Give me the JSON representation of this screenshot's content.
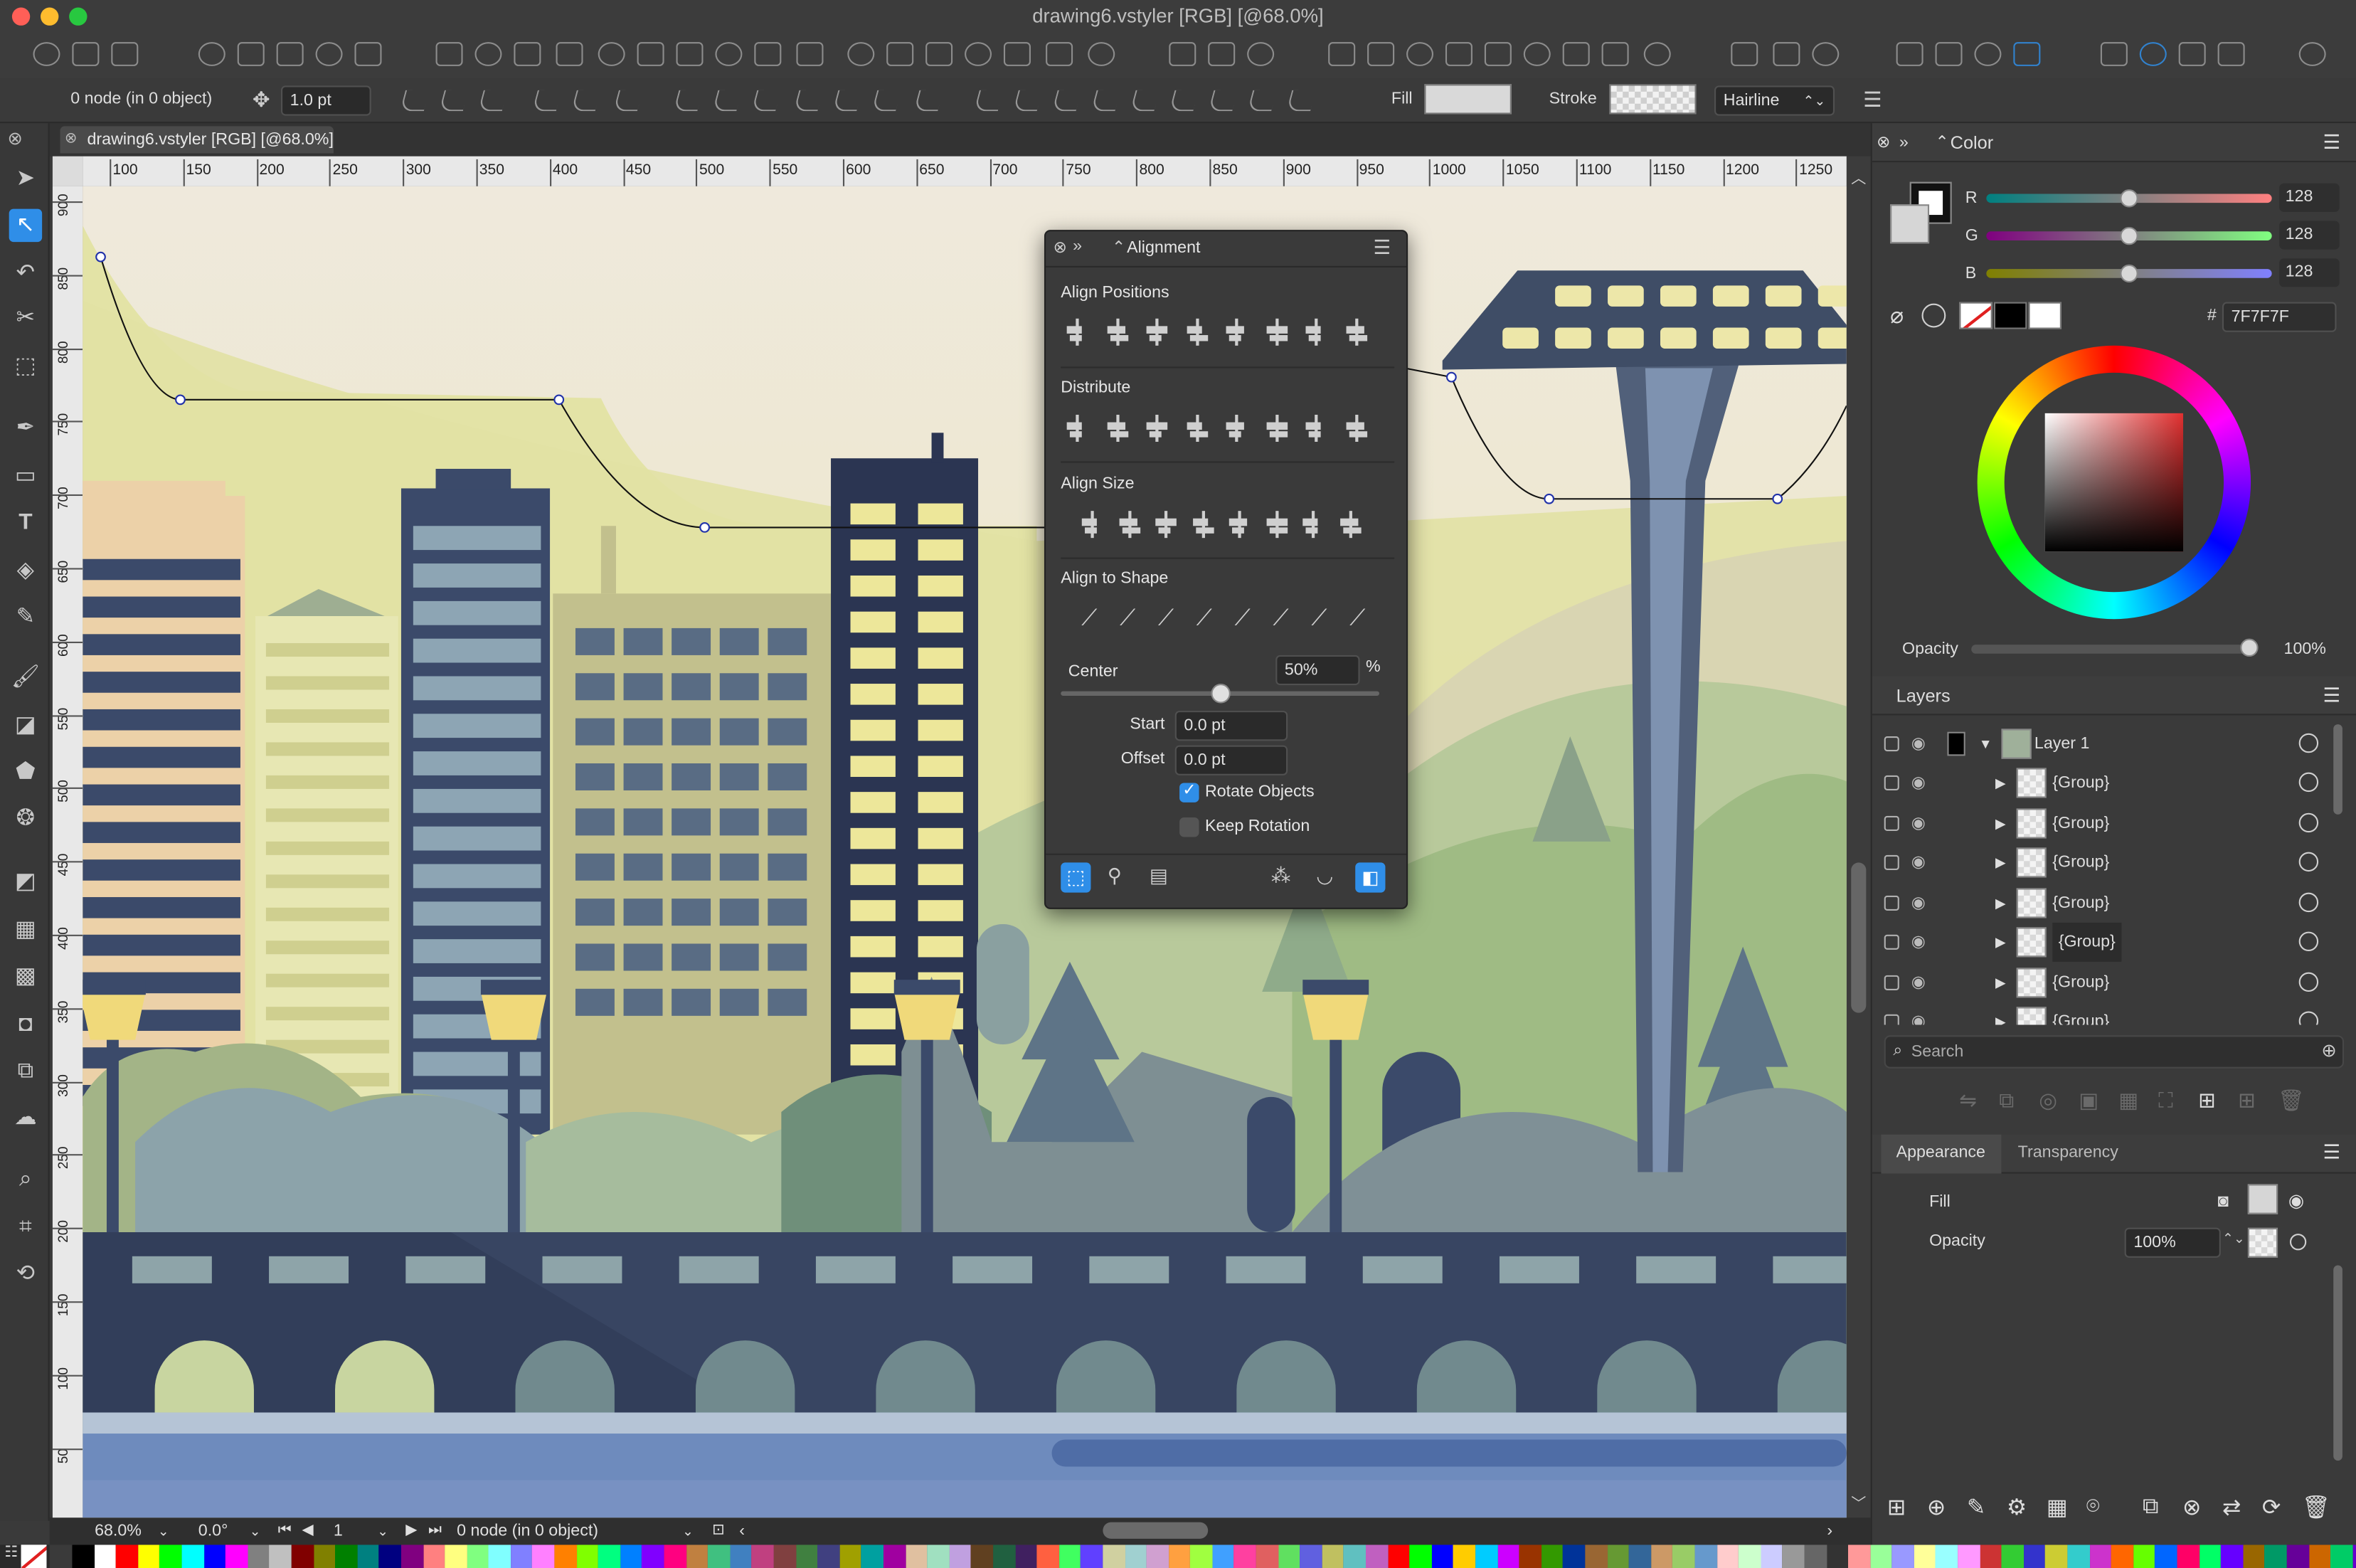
{
  "window": {
    "title": "drawing6.vstyler [RGB] [@68.0%]"
  },
  "toolbar": {
    "node_status": "0 node (in 0 object)",
    "stroke_width_value": "1.0 pt",
    "fill_label": "Fill",
    "stroke_label": "Stroke",
    "stroke_style": "Hairline"
  },
  "document_tab": {
    "label": "drawing6.vstyler [RGB] [@68.0%]"
  },
  "ruler": {
    "top_ticks": [
      "100",
      "150",
      "200",
      "250",
      "300",
      "350",
      "400",
      "450",
      "500",
      "550",
      "600",
      "650",
      "700",
      "750",
      "800",
      "850",
      "900",
      "950",
      "1000",
      "1050",
      "1100",
      "1150",
      "1200",
      "1250"
    ],
    "left_ticks": [
      "900",
      "850",
      "800",
      "750",
      "700",
      "650",
      "600",
      "550",
      "500",
      "450",
      "400",
      "350",
      "300",
      "250",
      "200",
      "150",
      "100",
      "50"
    ]
  },
  "alignment_panel": {
    "title": "Alignment",
    "align_positions": "Align Positions",
    "distribute": "Distribute",
    "align_size": "Align Size",
    "align_to_shape": "Align to Shape",
    "center_label": "Center",
    "center_value": "50%",
    "center_unit": "%",
    "center_fraction": 0.5,
    "start_label": "Start",
    "start_value": "0.0 pt",
    "offset_label": "Offset",
    "offset_value": "0.0 pt",
    "rotate_objects": "Rotate Objects",
    "rotate_checked": true,
    "keep_rotation": "Keep Rotation",
    "keep_checked": false
  },
  "color_panel": {
    "title": "Color",
    "channels": [
      {
        "label": "R",
        "value": "128"
      },
      {
        "label": "G",
        "value": "128"
      },
      {
        "label": "B",
        "value": "128"
      }
    ],
    "hex_prefix": "#",
    "hex": "7F7F7F",
    "opacity_label": "Opacity",
    "opacity_value": "100%"
  },
  "layers_panel": {
    "title": "Layers",
    "root": "Layer 1",
    "groups": [
      "{Group}",
      "{Group}",
      "{Group}",
      "{Group}",
      "{Group}",
      "{Group}",
      "{Group}"
    ],
    "search_placeholder": "Search"
  },
  "appearance_panel": {
    "tabs": [
      "Appearance",
      "Transparency"
    ],
    "fill_label": "Fill",
    "opacity_label": "Opacity",
    "opacity_value": "100%"
  },
  "status_bar": {
    "zoom": "68.0%",
    "rotation": "0.0°",
    "page": "1",
    "node_status": "0 node (in 0 object)"
  },
  "colors": {
    "accent": "#2f8ee8",
    "panel_bg": "#3a3a3a",
    "canvas_sky": "#efe9dc"
  },
  "palette": [
    "#000000",
    "#ffffff",
    "#ff0000",
    "#ffff00",
    "#00ff00",
    "#00ffff",
    "#0000ff",
    "#ff00ff",
    "#808080",
    "#c0c0c0",
    "#800000",
    "#808000",
    "#008000",
    "#008080",
    "#000080",
    "#800080",
    "#ff8080",
    "#ffff80",
    "#80ff80",
    "#80ffff",
    "#8080ff",
    "#ff80ff",
    "#ff8000",
    "#80ff00",
    "#00ff80",
    "#0080ff",
    "#8000ff",
    "#ff0080",
    "#c08040",
    "#40c080",
    "#4080c0",
    "#c04080",
    "#804040",
    "#408040",
    "#404080",
    "#a0a000",
    "#00a0a0",
    "#a000a0",
    "#e0c0a0",
    "#a0e0c0",
    "#c0a0e0",
    "#604020",
    "#206040",
    "#402060",
    "#ff6040",
    "#40ff60",
    "#6040ff",
    "#d0d0a0",
    "#a0d0d0",
    "#d0a0d0",
    "#ffa040",
    "#a0ff40",
    "#40a0ff",
    "#ff40a0",
    "#e06060",
    "#60e060",
    "#6060e0",
    "#c0c060",
    "#60c0c0",
    "#c060c0",
    "#ff0000",
    "#00ff00",
    "#0000ff",
    "#ffcc00",
    "#00ccff",
    "#cc00ff",
    "#993300",
    "#339900",
    "#003399",
    "#996633",
    "#669933",
    "#336699",
    "#cc9966",
    "#99cc66",
    "#6699cc",
    "#ffcccc",
    "#ccffcc",
    "#ccccff",
    "#999999",
    "#666666",
    "#333333",
    "#ff9999",
    "#99ff99",
    "#9999ff",
    "#ffff99",
    "#99ffff",
    "#ff99ff",
    "#cc3333",
    "#33cc33",
    "#3333cc",
    "#cccc33",
    "#33cccc",
    "#cc33cc",
    "#ff6600",
    "#66ff00",
    "#0066ff",
    "#ff0066",
    "#00ff66",
    "#6600ff",
    "#996600",
    "#009966",
    "#660099",
    "#cc6600",
    "#00cc66",
    "#6600cc"
  ]
}
